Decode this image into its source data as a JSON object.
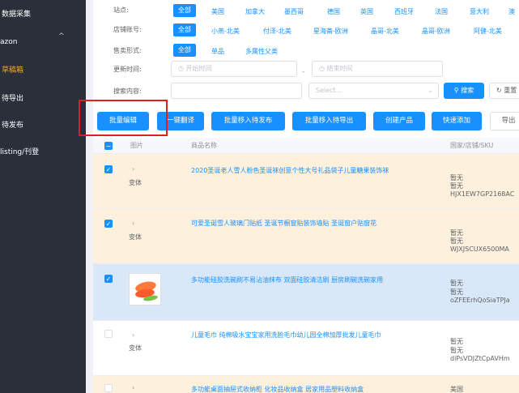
{
  "sidebar": {
    "items": [
      {
        "label": "数据采集",
        "active": false
      },
      {
        "label": "azon",
        "active": false
      },
      {
        "label": "草稿箱",
        "active": true
      },
      {
        "label": "待导出",
        "active": false
      },
      {
        "label": "待发布",
        "active": false
      },
      {
        "label": "listing/刊登",
        "active": false
      }
    ],
    "chevron": "^"
  },
  "filters": {
    "site": {
      "label": "站点:",
      "all": "全部",
      "options": [
        "美国",
        "加拿大",
        "墨西哥",
        "德国",
        "英国",
        "西班牙",
        "法国",
        "意大利",
        "澳"
      ]
    },
    "store": {
      "label": "店铺账号:",
      "all": "全部",
      "options": [
        "小燕-北美",
        "付泽-北美",
        "星海斋-欧洲",
        "晶哥-北美",
        "晶哥-欧洲",
        "阿健-北美"
      ]
    },
    "sale_form": {
      "label": "售卖形式:",
      "all": "全部",
      "options": [
        "单品",
        "多属性父类"
      ]
    },
    "update_time": {
      "label": "更新时间:",
      "start_placeholder": "开始时间",
      "end_placeholder": "结束时间",
      "separator": "-"
    },
    "search": {
      "label": "搜索内容:",
      "select_placeholder": "Select...",
      "search_button": "搜索",
      "reset_button": "重置"
    }
  },
  "toolbar": {
    "buttons": [
      "批量编辑",
      "一键翻译",
      "批量移入待发布",
      "批量移入待导出",
      "创建产品",
      "快速添加",
      "导出"
    ]
  },
  "table": {
    "headers": [
      "图片",
      "商品名称",
      "国家/店铺/SKU"
    ],
    "rows": [
      {
        "checked": true,
        "variant": "变体",
        "name": "2020圣诞老人雪人粉色圣诞袜创意个性大号礼品袋子儿童糖果装饰袜",
        "country": "暂无",
        "store": "暂无",
        "sku": "HJX1EW7GP2168AC"
      },
      {
        "checked": true,
        "variant": "变体",
        "name": "可爱圣诞雪人玻璃门贴纸 圣诞节橱窗贴装饰墙贴 圣诞窗户贴窗花",
        "country": "暂无",
        "store": "暂无",
        "sku": "WJXJSCUX6500MA"
      },
      {
        "checked": true,
        "variant": "",
        "name": "多功能硅胶洗碗刷不易沾油抹布 双面硅胶清洁刷 厨房刷碗洗碗家用",
        "country": "暂无",
        "store": "暂无",
        "sku": "oZFEErhQoSiaTPJa"
      },
      {
        "checked": false,
        "variant": "变体",
        "name": "儿童毛巾 纯棉吸水宝宝家用洗脸毛巾幼儿园全棉加厚批发儿童毛巾",
        "country": "暂无",
        "store": "暂无",
        "sku": "diPsVDJZtCpAVHm"
      },
      {
        "checked": false,
        "variant": "",
        "name": "多功能桌面抽屉式收纳柜 化妆品收纳盒 居家用品塑料收纳盒",
        "country": "美国",
        "store": "",
        "sku": ""
      }
    ]
  },
  "colors": {
    "primary": "#1890ff",
    "sidebar": "#2b2f3a",
    "active": "#f5a623",
    "highlight": "#e02020"
  }
}
